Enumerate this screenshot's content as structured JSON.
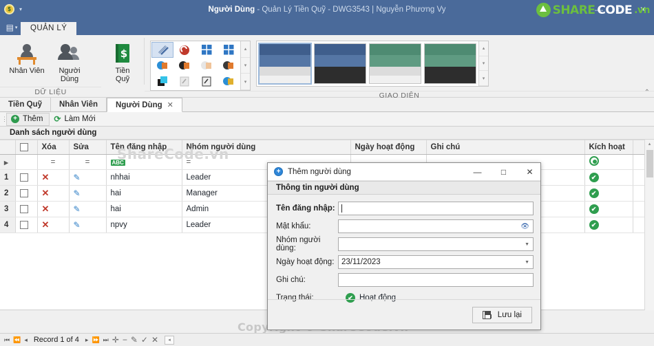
{
  "titlebar": {
    "app_icon": "app-logo-icon",
    "caret": "▾",
    "title_main": "Người Dùng",
    "title_rest": " - Quản Lý Tiền Quỹ - DWG3543 | Nguyễn Phương Vy",
    "minimize": "—",
    "maximize": "□",
    "close": "✕",
    "brand_share": "SHARE",
    "brand_code": "CODE",
    "brand_vn": ".vn",
    "accent_blue": "#4a6a9a",
    "accent_green": "#6cbf3f"
  },
  "ribbon": {
    "app_menu": "▤",
    "app_menu_caret": "▾",
    "tabs": [
      {
        "label": "QUẢN LÝ",
        "active": true
      }
    ],
    "groups": [
      {
        "label": "DỮ LIỆU",
        "buttons": [
          {
            "label": "Nhân Viên",
            "icon": "employee-icon"
          },
          {
            "label": "Người Dùng",
            "icon": "users-icon"
          },
          {
            "label": "Tiền Quỹ",
            "icon": "money-book-icon"
          }
        ]
      },
      {
        "label": "GIAO DIỆN"
      }
    ],
    "collapse_icon": "⌃",
    "gallery_scroll": {
      "up": "▴",
      "down": "▾",
      "more": "▾"
    },
    "themes": [
      {
        "name": "blue-light",
        "top": "#3f5e8c",
        "mid": "#5576a5",
        "body": "#dcdcdc",
        "foot": "#f0f0f0",
        "selected": true
      },
      {
        "name": "blue-dark",
        "top": "#3f5e8c",
        "mid": "#5576a5",
        "body": "#2d2d2d",
        "foot": "#2d2d2d",
        "selected": false
      },
      {
        "name": "green-light",
        "top": "#4e8b72",
        "mid": "#5f9b82",
        "body": "#dcdcdc",
        "foot": "#f0f0f0",
        "selected": false
      },
      {
        "name": "green-dark",
        "top": "#4e8b72",
        "mid": "#5f9b82",
        "body": "#2d2d2d",
        "foot": "#2d2d2d",
        "selected": false
      }
    ]
  },
  "doctabs": [
    {
      "label": "Tiền Quỹ",
      "active": false,
      "closable": false
    },
    {
      "label": "Nhân Viên",
      "active": false,
      "closable": false
    },
    {
      "label": "Người Dùng",
      "active": true,
      "closable": true,
      "close": "✕"
    }
  ],
  "toolbar": {
    "grip": "⋮",
    "add_label": "Thêm",
    "add_icon": "plus-circle-icon",
    "refresh_label": "Làm Mới",
    "refresh_icon": "refresh-icon"
  },
  "list_caption": "Danh sách người dùng",
  "grid": {
    "columns": [
      "",
      "",
      "Xóa",
      "Sửa",
      "Tên đăng nhập",
      "Nhóm người dùng",
      "Ngày hoạt động",
      "Ghi chú",
      "Kích hoạt"
    ],
    "filter_row": {
      "indicator": "▸",
      "delete_op": "=",
      "edit_op": "=",
      "username_icon": "abc-filter-icon",
      "username_icon_text": "ABC",
      "group_op": "=",
      "activate": "radio-selected-icon"
    },
    "rows": [
      {
        "no": "1",
        "checked": false,
        "delete_icon": "✕",
        "edit_icon": "✎",
        "username": "nhhai",
        "group": "Leader",
        "day": "",
        "note": "",
        "active": "✔"
      },
      {
        "no": "2",
        "checked": false,
        "delete_icon": "✕",
        "edit_icon": "✎",
        "username": "hai",
        "group": "Manager",
        "day": "",
        "note": "",
        "active": "✔"
      },
      {
        "no": "3",
        "checked": false,
        "delete_icon": "✕",
        "edit_icon": "✎",
        "username": "hai",
        "group": "Admin",
        "day": "",
        "note": "",
        "active": "✔"
      },
      {
        "no": "4",
        "checked": false,
        "delete_icon": "✕",
        "edit_icon": "✎",
        "username": "npvy",
        "group": "Leader",
        "day": "",
        "note": "",
        "active": "✔"
      }
    ],
    "watermark": "ShareCode.vn",
    "scroll": {
      "up": "▴",
      "down": "▾"
    }
  },
  "page_watermark": "Copyright © ShareCode.vn",
  "statusbar": {
    "first": "⏮",
    "prev_page": "⏪",
    "prev": "◂",
    "record_label": "Record 1 of 4",
    "next": "▸",
    "next_page": "⏩",
    "last": "⏭",
    "add": "✛",
    "remove": "−",
    "edit": "✎",
    "accept": "✓",
    "cancel": "✕",
    "filter_box": "◂"
  },
  "dialog": {
    "icon": "add-circle-icon",
    "title": "Thêm người dùng",
    "minimize": "—",
    "maximize": "□",
    "close": "✕",
    "section": "Thông tin người dùng",
    "fields": [
      {
        "label": "Tên đăng nhập:",
        "value": "",
        "bold": true,
        "type": "text",
        "focused": true
      },
      {
        "label": "Mật khẩu:",
        "value": "",
        "bold": false,
        "type": "password",
        "icon": "eye-icon"
      },
      {
        "label": "Nhóm người dùng:",
        "value": "",
        "bold": false,
        "type": "select",
        "icon": "chevron-down-icon"
      },
      {
        "label": "Ngày hoạt động:",
        "value": "23/11/2023",
        "bold": false,
        "type": "date",
        "icon": "chevron-down-icon"
      },
      {
        "label": "Ghi chú:",
        "value": "",
        "bold": false,
        "type": "text"
      }
    ],
    "status_label": "Trạng thái:",
    "status_value": "Hoạt động",
    "status_icon": "check-circle-icon",
    "save_label": "Lưu lại",
    "save_icon": "save-icon"
  }
}
